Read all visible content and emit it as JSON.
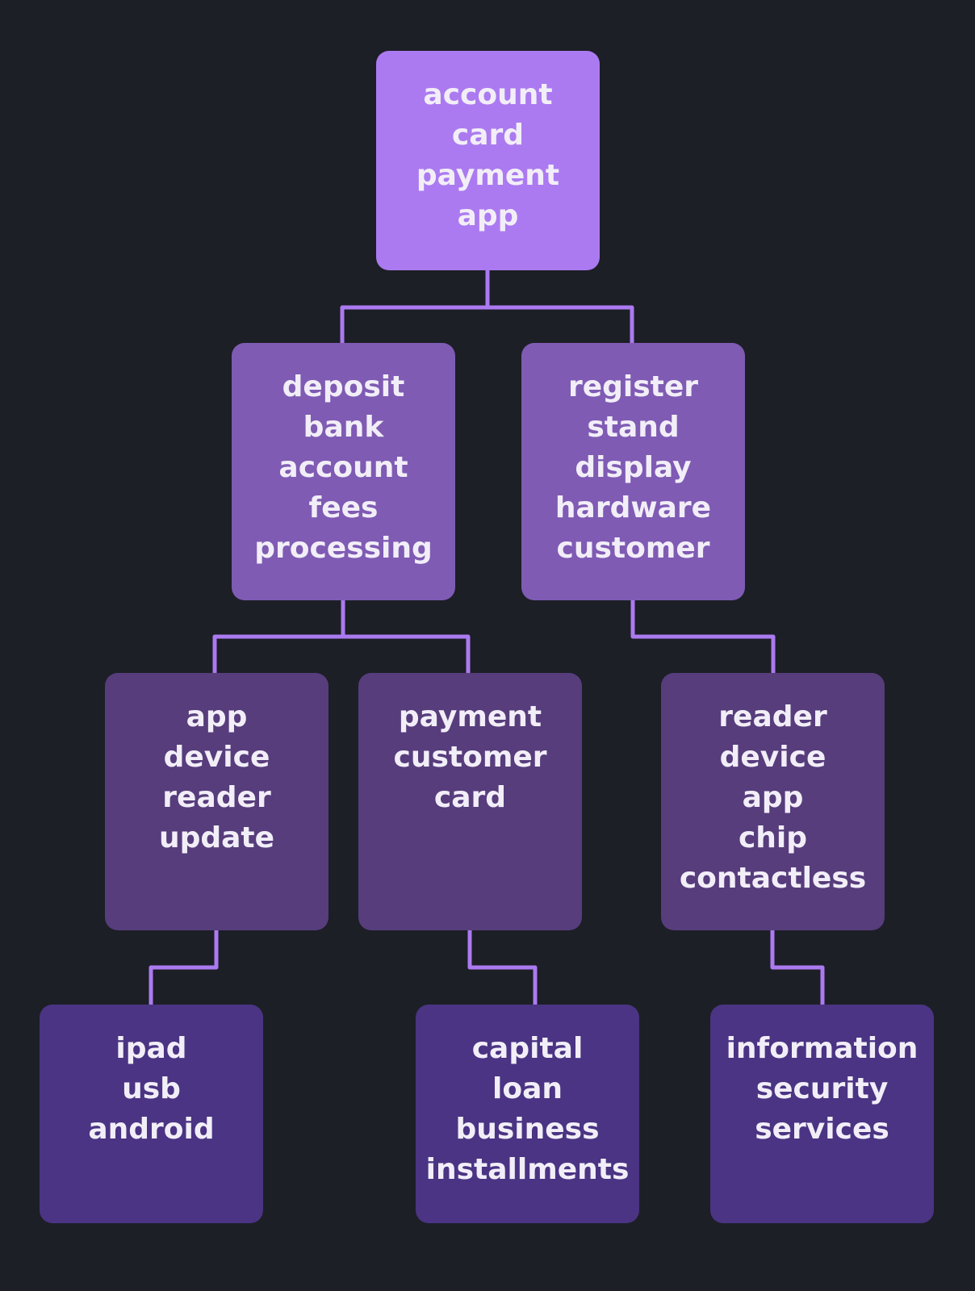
{
  "colors": {
    "background": "#1c1f26",
    "connector": "#ab7af0",
    "level1": "#ab7af0",
    "level2": "#7f5bb4",
    "level3": "#573d7c",
    "level4": "#4a3483"
  },
  "nodes": {
    "root": [
      "account",
      "card",
      "payment",
      "app"
    ],
    "l2_left": [
      "deposit",
      "bank",
      "account",
      "fees",
      "processing"
    ],
    "l2_right": [
      "register",
      "stand",
      "display",
      "hardware",
      "customer"
    ],
    "l3_left": [
      "app",
      "device",
      "reader",
      "update"
    ],
    "l3_mid": [
      "payment",
      "customer",
      "card"
    ],
    "l3_right": [
      "reader",
      "device",
      "app",
      "chip",
      "contactless"
    ],
    "l4_left": [
      "ipad",
      "usb",
      "android"
    ],
    "l4_mid": [
      "capital",
      "loan",
      "business",
      "installments"
    ],
    "l4_right": [
      "information",
      "security",
      "services"
    ]
  }
}
